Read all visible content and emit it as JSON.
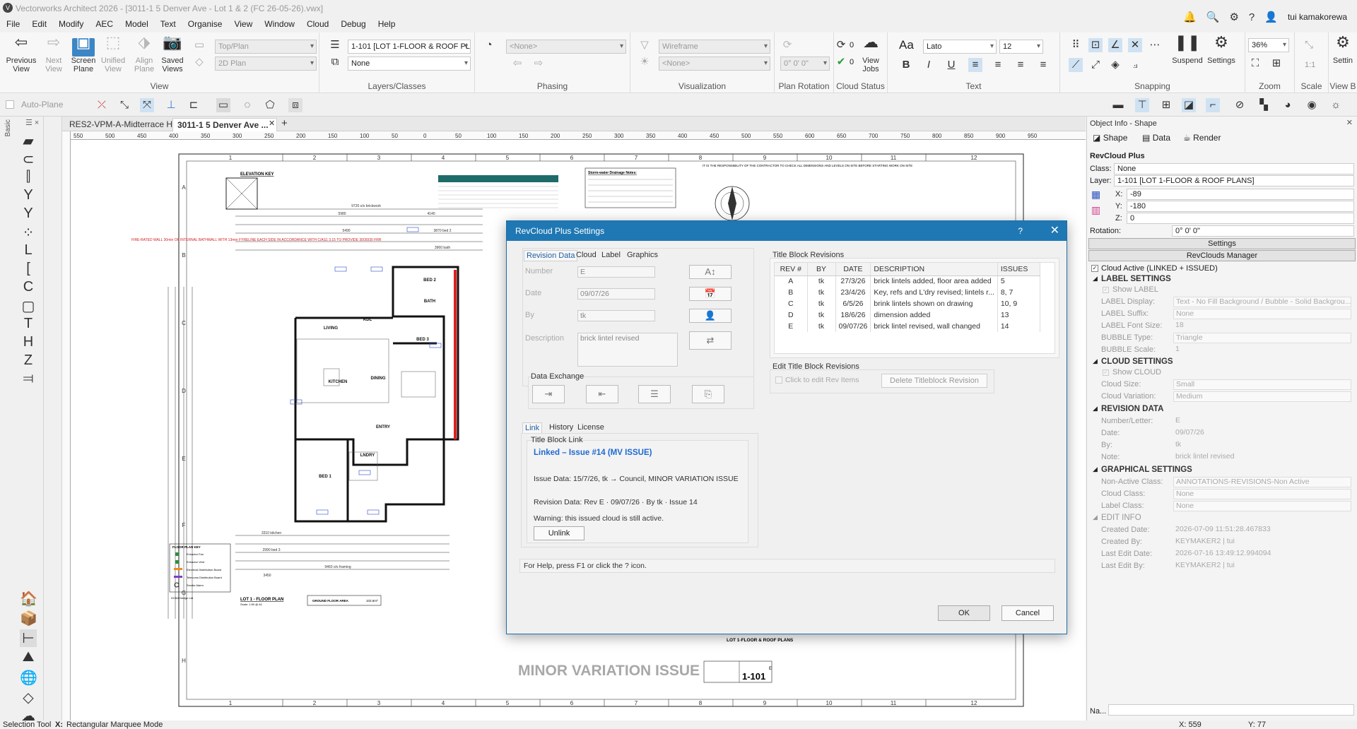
{
  "window": {
    "title": "Vectorworks Architect 2026 - [3011-1 5 Denver Ave - Lot 1 & 2 (FC 26-05-26).vwx]"
  },
  "menu": [
    "File",
    "Edit",
    "Modify",
    "AEC",
    "Model",
    "Text",
    "Organise",
    "View",
    "Window",
    "Cloud",
    "Debug",
    "Help"
  ],
  "user": "tui kamakorewa",
  "ribbon": {
    "view": {
      "label": "View",
      "buttons": [
        "Previous View",
        "Next View",
        "Screen Plane",
        "Unified View",
        "Align Plane",
        "Saved Views"
      ],
      "combo1": "Top/Plan",
      "combo2": "2D Plan"
    },
    "layers": {
      "label": "Layers/Classes",
      "layer": "1-101 [LOT 1-FLOOR & ROOF PL",
      "class": "None"
    },
    "phasing": {
      "label": "Phasing",
      "combo": "<None>"
    },
    "visualization": {
      "label": "Visualization",
      "render": "Wireframe",
      "light": "<None>"
    },
    "rotation": {
      "label": "Plan Rotation",
      "value": "0° 0' 0\""
    },
    "cloud": {
      "label": "Cloud Status",
      "count1": "0",
      "count2": "0",
      "viewjobs": "View Jobs"
    },
    "text": {
      "label": "Text",
      "font": "Lato",
      "size": "12"
    },
    "snapping": {
      "label": "Snapping",
      "suspend": "Suspend",
      "settings": "Settings"
    },
    "zoom": {
      "label": "Zoom",
      "value": "36%"
    },
    "scale": {
      "label": "Scale",
      "value": "1:1"
    },
    "viewbar": {
      "label": "View B",
      "settings": "Settin"
    }
  },
  "toolbar2": {
    "autoplane": "Auto-Plane"
  },
  "palette": {
    "label": "Basic"
  },
  "tabs": [
    "RES2-VPM-A-Midterrace H...",
    "3011-1 5 Denver Ave ..."
  ],
  "ruler": [
    "550",
    "500",
    "450",
    "400",
    "350",
    "300",
    "250",
    "200",
    "150",
    "100",
    "50",
    "0",
    "50",
    "100",
    "150",
    "200",
    "250",
    "300",
    "350",
    "400",
    "450",
    "500",
    "550",
    "600",
    "650",
    "700",
    "750",
    "800",
    "850",
    "900",
    "950"
  ],
  "drawing": {
    "cols": [
      "1",
      "2",
      "3",
      "4",
      "5",
      "6",
      "7",
      "8",
      "9",
      "10",
      "11",
      "12"
    ],
    "rows": [
      "A",
      "B",
      "C",
      "D",
      "E",
      "F",
      "G",
      "H"
    ],
    "elevation_key": "ELEVATION KEY",
    "floor_plan": "LOT 1 - FLOOR PLAN",
    "floor_plan_scale": "Scale: 1:50 @ A1",
    "ground_area": "GROUND FLOOR AREA",
    "ground_area_value": "103.6m²",
    "floor_key": "FLOOR PLAN KEY",
    "key_items": [
      "Extractor Fan",
      "Extractor Vent",
      "Electrical Distribution Board",
      "Telecoms Distribution Board",
      "Smoke Alarm"
    ],
    "company": "DCBA Design Ltd",
    "title_block": "LOT 1-FLOOR & ROOF PLANS",
    "sheet": "1-101",
    "sheet_rev": "E",
    "issue_stamp": "MINOR VARIATION ISSUE",
    "stormwater": "Storm-water Drainage Notes:",
    "note_right": "IT IS THE RESPONSIBILITY OF THE CONTRACTOR TO CHECK ALL DIMENSIONS AND LEVELS ON SITE BEFORE STARTING WORK ON SITE",
    "rooms": [
      "LIVING",
      "KDL",
      "DINING",
      "KITCHEN",
      "BED 1",
      "BED 2",
      "BED 3",
      "BATH",
      "ENTRY",
      "LNDRY"
    ],
    "dims_top": [
      "9720 o/s brickwork",
      "5980",
      "4140",
      "5490",
      "3870 bed 2",
      "3960 bath"
    ],
    "dims_bottom": [
      "3310 kitchen",
      "2990 bed 3",
      "9460 o/s framing",
      "3450"
    ],
    "red_note": "FIRE-RATED WALL 30min OF INTERNAL BATHWALL WITH 13mm FYRELINE EACH SIDE IN ACCORDANCE WITH C/AS1 3.15 TO PROVIDE 30/30/30 FRR"
  },
  "oip": {
    "header": "Object Info - Shape",
    "tabs": [
      "Shape",
      "Data",
      "Render"
    ],
    "object": "RevCloud Plus",
    "class_label": "Class:",
    "class": "None",
    "layer_label": "Layer:",
    "layer": "1-101 [LOT 1-FLOOR & ROOF PLANS]",
    "x_label": "X:",
    "x": "-89",
    "y_label": "Y:",
    "y": "-180",
    "z_label": "Z:",
    "z": "0",
    "rotation_label": "Rotation:",
    "rotation": "0° 0' 0\"",
    "settings_btn": "Settings",
    "manager_btn": "RevClouds Manager",
    "cloud_active": "Cloud Active (LINKED + ISSUED)",
    "sections": {
      "label": {
        "title": "LABEL SETTINGS",
        "show": "Show LABEL",
        "display_l": "LABEL Display:",
        "display": "Text - No Fill Background / Bubble - Solid Backgrou...",
        "suffix_l": "LABEL Suffix:",
        "suffix": "None",
        "font_l": "LABEL Font Size:",
        "font": "18",
        "bubble_l": "BUBBLE Type:",
        "bubble": "Triangle",
        "scale_l": "BUBBLE Scale:",
        "scale": "1"
      },
      "cloud": {
        "title": "CLOUD SETTINGS",
        "show": "Show CLOUD",
        "size_l": "Cloud Size:",
        "size": "Small",
        "var_l": "Cloud Variation:",
        "var": "Medium"
      },
      "rev": {
        "title": "REVISION DATA",
        "num_l": "Number/Letter:",
        "num": "E",
        "date_l": "Date:",
        "date": "09/07/26",
        "by_l": "By:",
        "by": "tk",
        "note_l": "Note:",
        "note": "brick lintel revised"
      },
      "graph": {
        "title": "GRAPHICAL SETTINGS",
        "nonactive_l": "Non-Active Class:",
        "nonactive": "ANNOTATIONS-REVISIONS-Non Active",
        "cloudc_l": "Cloud Class:",
        "cloudc": "None",
        "labelc_l": "Label Class:",
        "labelc": "None"
      },
      "edit": {
        "title": "EDIT INFO",
        "created_l": "Created Date:",
        "created": "2026-07-09 11:51:28.467833",
        "createdby_l": "Created By:",
        "createdby": "KEYMAKER2 | tui",
        "lastedit_l": "Last Edit Date:",
        "lastedit": "2026-07-16 13:49:12.994094",
        "lasteditby_l": "Last Edit By:",
        "lasteditby": "KEYMAKER2 | tui"
      }
    },
    "name_label": "Na..."
  },
  "dialog": {
    "title": "RevCloud Plus Settings",
    "help": "?",
    "tabs": [
      "Revision Data",
      "Cloud",
      "Label",
      "Graphics"
    ],
    "number_l": "Number",
    "number": "E",
    "date_l": "Date",
    "date": "09/07/26",
    "by_l": "By",
    "by": "tk",
    "desc_l": "Description",
    "desc": "brick lintel revised",
    "data_exchange": "Data Exchange",
    "tbr": {
      "title": "Title Block Revisions",
      "headers": [
        "REV #",
        "BY",
        "DATE",
        "DESCRIPTION",
        "ISSUES"
      ],
      "rows": [
        [
          "A",
          "tk",
          "27/3/26",
          "brick lintels added, floor area added",
          "5"
        ],
        [
          "B",
          "tk",
          "23/4/26",
          "Key, refs and L'dry revised; lintels r...",
          "8, 7"
        ],
        [
          "C",
          "tk",
          "6/5/26",
          "brink lintels shown on drawing",
          "10, 9"
        ],
        [
          "D",
          "tk",
          "18/6/26",
          "dimension added",
          "13"
        ],
        [
          "E",
          "tk",
          "09/07/26",
          "brick lintel revised, wall changed",
          "14"
        ]
      ]
    },
    "edit_tbr": "Edit Title Block Revisions",
    "click_edit": "Click to edit Rev Items",
    "delete_btn": "Delete Titleblock Revision",
    "link_tabs": [
      "Link",
      "History",
      "License"
    ],
    "tbl": "Title Block Link",
    "linked": "Linked – Issue #14 (MV ISSUE)",
    "issue_data": "Issue Data: 15/7/26, tk → Council, MINOR VARIATION ISSUE",
    "revision_data": "Revision Data: Rev E · 09/07/26 · By tk · Issue 14",
    "warning": "Warning: this issued cloud is still active.",
    "unlink": "Unlink",
    "help_text": "For Help, press F1 or click the ? icon.",
    "ok": "OK",
    "cancel": "Cancel"
  },
  "status": {
    "tool": "Selection Tool",
    "mode_key": "X:",
    "mode": "Rectangular Marquee Mode",
    "x": "X: 559",
    "y": "Y: 77"
  }
}
